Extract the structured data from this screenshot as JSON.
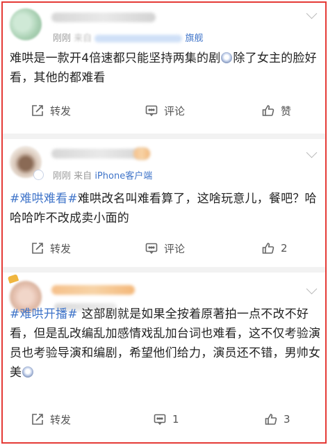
{
  "posts": [
    {
      "name": "",
      "meta": {
        "time": "刚刚",
        "source_prefix": "来自",
        "source": "",
        "brand": "旗舰"
      },
      "text": [
        {
          "t": "难哄是一款开4倍速都只能坚持两集的剧"
        },
        {
          "emoji": "face-emoji"
        },
        {
          "t": "除了女主的脸好看，其他的都难看"
        }
      ],
      "actions": {
        "repost": "转发",
        "comment": "评论",
        "like": "赞"
      }
    },
    {
      "name": "",
      "meta": {
        "time": "刚刚",
        "source_prefix": "来自",
        "source": "iPhone客户端"
      },
      "text": [
        {
          "tag": "#难哄难看#"
        },
        {
          "t": "难哄改名叫难看算了，这啥玩意儿，餐吧？哈哈哈咋不改成卖小面的"
        }
      ],
      "actions": {
        "repost": "转发",
        "comment": "评论",
        "like": "2"
      }
    },
    {
      "name": "",
      "text": [
        {
          "tag": "#难哄开播#"
        },
        {
          "t": " 这部剧就是如果全按着原著拍一点不改不好看，但是乱改编乱加感情戏乱加台词也难看，这不仅考验演员也考验导演和编剧，希望他们给力，演员还不错，男帅女美"
        },
        {
          "emoji": "face-emoji"
        }
      ],
      "actions": {
        "repost": "转发",
        "comment": "1",
        "like": "3"
      }
    }
  ],
  "colors": {
    "accent": "#3f74c9",
    "border": "#e53935"
  }
}
